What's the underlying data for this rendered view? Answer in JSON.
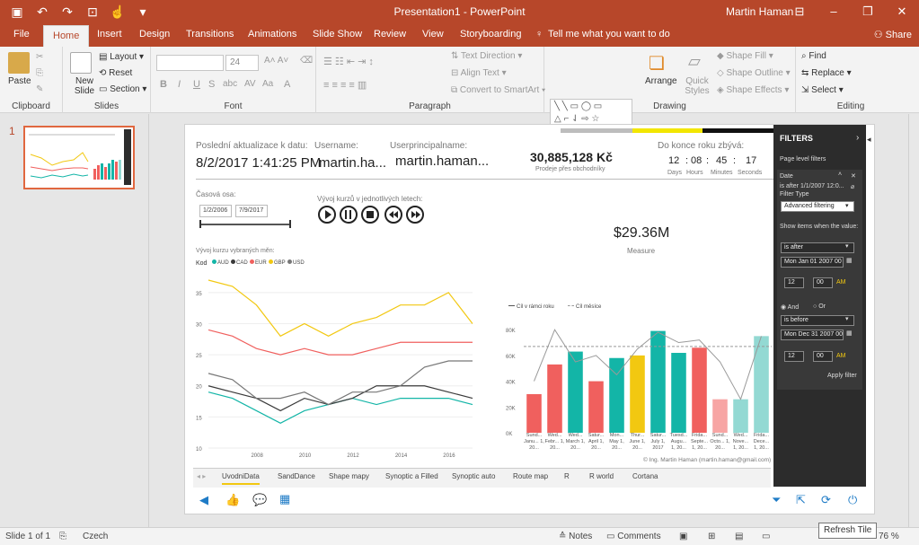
{
  "titlebar": {
    "title": "Presentation1 - PowerPoint",
    "user": "Martin Haman",
    "qat_icons": [
      "save-icon",
      "undo-icon",
      "redo-icon",
      "present-icon",
      "touch-mode-icon",
      "customize-icon"
    ],
    "window_controls": [
      "minimize-icon",
      "restore-icon",
      "close-icon"
    ]
  },
  "tabs": [
    {
      "label": "File"
    },
    {
      "label": "Home"
    },
    {
      "label": "Insert"
    },
    {
      "label": "Design"
    },
    {
      "label": "Transitions"
    },
    {
      "label": "Animations"
    },
    {
      "label": "Slide Show"
    },
    {
      "label": "Review"
    },
    {
      "label": "View"
    },
    {
      "label": "Storyboarding"
    },
    {
      "label": "Tell me what you want to do"
    }
  ],
  "share_label": "Share",
  "ribbon": {
    "clipboard": {
      "paste": "Paste",
      "group": "Clipboard"
    },
    "slides": {
      "new_slide": "New Slide",
      "layout": "Layout",
      "reset": "Reset",
      "section": "Section",
      "group": "Slides"
    },
    "font": {
      "size": "24",
      "group": "Font"
    },
    "paragraph": {
      "text_direction": "Text Direction",
      "align_text": "Align Text",
      "smartart": "Convert to SmartArt",
      "group": "Paragraph"
    },
    "drawing": {
      "arrange": "Arrange",
      "quick_styles": "Quick Styles",
      "shape_fill": "Shape Fill",
      "shape_outline": "Shape Outline",
      "shape_effects": "Shape Effects",
      "group": "Drawing"
    },
    "editing": {
      "find": "Find",
      "replace": "Replace",
      "select": "Select",
      "group": "Editing"
    }
  },
  "thumb": {
    "number": "1"
  },
  "slide": {
    "last_update_label": "Poslední aktualizace k datu:",
    "last_update_value": "8/2/2017 1:41:25 PM",
    "username_label": "Username:",
    "username_value": "martin.ha...",
    "upn_label": "Userprincipalname:",
    "upn_value": "martin.haman...",
    "sales_value": "30,885,128 Kč",
    "sales_caption": "Prodeje přes obchodníky",
    "countdown_label": "Do konce roku zbývá:",
    "countdown": {
      "days": "12",
      "hours": "08",
      "minutes": "45",
      "seconds": "17"
    },
    "countdown_units": {
      "days": "Days",
      "hours": "Hours",
      "minutes": "Minutes",
      "seconds": "Seconds"
    },
    "time_axis_label": "Časová osa:",
    "date_from": "1/2/2006",
    "date_to": "7/9/2017",
    "currency_dev_label": "Vývoj kurzů v jednotlivých letech:",
    "measure_value": "$29.36M",
    "measure_caption": "Measure",
    "copyright": "© Ing. Martin Haman (martin.haman@gmail.com)"
  },
  "chart_data": [
    {
      "type": "line",
      "title": "Vývoj kurzu vybraných měn:",
      "legend_title": "Kod",
      "legend_position": "top-left",
      "x": [
        2006,
        2007,
        2008,
        2009,
        2010,
        2011,
        2012,
        2013,
        2014,
        2015,
        2016,
        2017
      ],
      "x_ticks": [
        "2008",
        "2010",
        "2012",
        "2014",
        "2016"
      ],
      "y_ticks": [
        "10",
        "15",
        "20",
        "25",
        "30",
        "35"
      ],
      "ylim": [
        10,
        37
      ],
      "series": [
        {
          "name": "AUD",
          "color": "#13b5a7",
          "values": [
            19,
            18,
            16,
            14,
            16,
            17,
            18,
            17,
            18,
            18,
            18,
            17
          ]
        },
        {
          "name": "CAD",
          "color": "#3a3a3a",
          "values": [
            20,
            19,
            18,
            16,
            18,
            17,
            18,
            20,
            20,
            20,
            19,
            18
          ]
        },
        {
          "name": "EUR",
          "color": "#f0605e",
          "values": [
            29,
            28,
            26,
            25,
            26,
            25,
            25,
            26,
            27,
            27,
            27,
            27
          ]
        },
        {
          "name": "GBP",
          "color": "#f2c811",
          "values": [
            37,
            36,
            33,
            28,
            30,
            28,
            30,
            31,
            33,
            33,
            35,
            30
          ]
        },
        {
          "name": "USD",
          "color": "#777777",
          "values": [
            22,
            21,
            18,
            18,
            19,
            17,
            19,
            19,
            20,
            23,
            24,
            24
          ]
        }
      ]
    },
    {
      "type": "bar",
      "legend_position": "top-left",
      "legend": [
        "Cíl v rámci roku",
        "Cíl měsíce"
      ],
      "categories": [
        "Sund... Janu... 1, 20...",
        "Wed... Febr... 1, 20...",
        "Wed... March 1, 20...",
        "Satur... April 1, 20...",
        "Mon... May 1, 20...",
        "Thur... June 1, 20...",
        "Satur... July 1, 2017",
        "Tuesd... Augu... 1, 20...",
        "Frida... Septe... 1, 20...",
        "Sund... Octo... 1, 20...",
        "Wed... Nove... 1, 20...",
        "Frida... Dece... 1, 20..."
      ],
      "values": [
        30000,
        53000,
        63000,
        40000,
        58000,
        60000,
        79000,
        62000,
        66000,
        26000,
        26000,
        75000
      ],
      "colors": [
        "#f0605e",
        "#f0605e",
        "#13b5a7",
        "#f0605e",
        "#13b5a7",
        "#f2c811",
        "#13b5a7",
        "#13b5a7",
        "#f0605e",
        "#f7a5a4",
        "#93d9d3",
        "#93d9d3"
      ],
      "target_line": [
        40000,
        80000,
        55000,
        60000,
        45000,
        65000,
        78000,
        70000,
        72000,
        55000,
        26000,
        75000
      ],
      "month_target": 67000,
      "y_ticks": [
        "0K",
        "20K",
        "40K",
        "60K",
        "80K"
      ],
      "ylim": [
        0,
        85000
      ]
    }
  ],
  "filters": {
    "title": "FILTERS",
    "section": "Page level filters",
    "field": "Date",
    "summary": "is after 1/1/2007 12:0...",
    "filter_type_label": "Filter Type",
    "filter_type": "Advanced filtering",
    "show_items_label": "Show items when the value:",
    "op1": "is after",
    "date1": "Mon Jan 01 2007 00",
    "hour1": "12",
    "min1": "00",
    "ampm1": "AM",
    "and_label": "And",
    "or_label": "Or",
    "op2": "is before",
    "date2": "Mon Dec 31 2007 00",
    "hour2": "12",
    "min2": "00",
    "ampm2": "AM",
    "apply": "Apply filter"
  },
  "pagetabs": [
    "UvodniData",
    "SandDance",
    "Shape mapy",
    "Synoptic a Filled",
    "Synoptic auto",
    "Route map",
    "R",
    "R world",
    "Cortana"
  ],
  "statusbar": {
    "slide_info": "Slide 1 of 1",
    "language": "Czech",
    "notes": "Notes",
    "comments": "Comments",
    "zoom": "76 %",
    "tooltip": "Refresh Tile"
  }
}
